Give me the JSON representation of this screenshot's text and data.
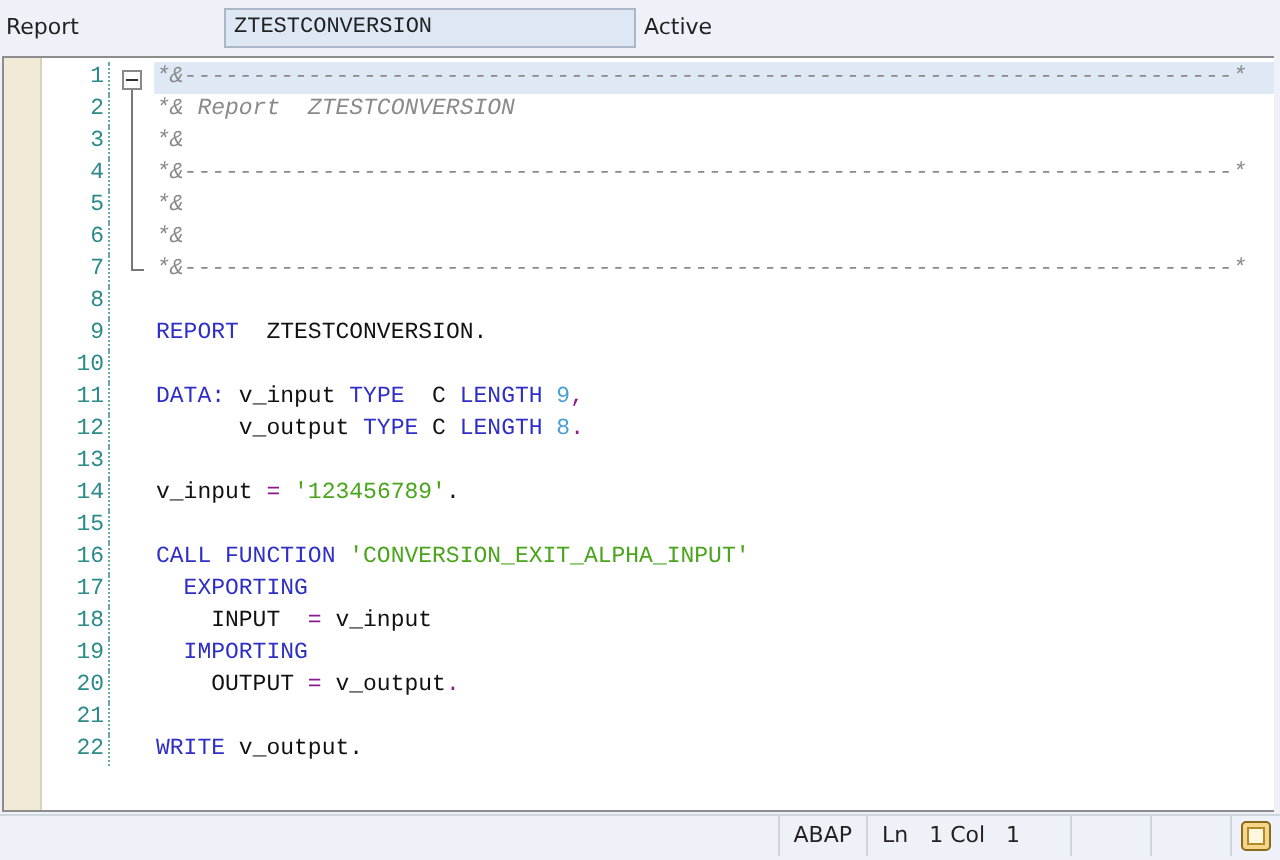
{
  "header": {
    "label": "Report",
    "program": "ZTESTCONVERSION",
    "status": "Active"
  },
  "editor": {
    "lines": [
      {
        "number": "1",
        "current": true,
        "expanded": true,
        "tokens": [
          {
            "kind": "comment",
            "text": "*&----------------------------------------------------------------------------*"
          }
        ],
        "children": [
          {
            "number": "2",
            "current": false,
            "tokens": [
              {
                "kind": "comment",
                "text": "*& Report  ZTESTCONVERSION"
              }
            ]
          },
          {
            "number": "3",
            "current": false,
            "tokens": [
              {
                "kind": "comment",
                "text": "*&"
              }
            ]
          },
          {
            "number": "4",
            "current": false,
            "tokens": [
              {
                "kind": "comment",
                "text": "*&----------------------------------------------------------------------------*"
              }
            ]
          },
          {
            "number": "5",
            "current": false,
            "tokens": [
              {
                "kind": "comment",
                "text": "*&"
              }
            ]
          },
          {
            "number": "6",
            "current": false,
            "tokens": [
              {
                "kind": "comment",
                "text": "*&"
              }
            ]
          },
          {
            "number": "7",
            "current": false,
            "tokens": [
              {
                "kind": "comment",
                "text": "*&----------------------------------------------------------------------------*"
              }
            ]
          }
        ]
      },
      {
        "number": "8",
        "current": false
      },
      {
        "number": "9",
        "current": false,
        "tokens": [
          {
            "kind": "keyword",
            "text": "REPORT"
          },
          {
            "kind": "plain",
            "text": "  ZTESTCONVERSION."
          }
        ]
      },
      {
        "number": "10",
        "current": false
      },
      {
        "number": "11",
        "current": false,
        "tokens": [
          {
            "kind": "keyword",
            "text": "DATA:"
          },
          {
            "kind": "plain",
            "text": " v_input "
          },
          {
            "kind": "keyword",
            "text": "TYPE"
          },
          {
            "kind": "plain",
            "text": "  C "
          },
          {
            "kind": "keyword",
            "text": "LENGTH "
          },
          {
            "kind": "number",
            "text": "9"
          },
          {
            "kind": "punct",
            "text": ","
          }
        ]
      },
      {
        "number": "12",
        "current": false,
        "tokens": [
          {
            "kind": "plain",
            "text": "      v_output "
          },
          {
            "kind": "keyword",
            "text": "TYPE"
          },
          {
            "kind": "plain",
            "text": " C "
          },
          {
            "kind": "keyword",
            "text": "LENGTH "
          },
          {
            "kind": "number",
            "text": "8"
          },
          {
            "kind": "punct",
            "text": "."
          }
        ]
      },
      {
        "number": "13",
        "current": false
      },
      {
        "number": "14",
        "current": false,
        "tokens": [
          {
            "kind": "plain",
            "text": "v_input "
          },
          {
            "kind": "punct",
            "text": "= "
          },
          {
            "kind": "string",
            "text": "'123456789'"
          },
          {
            "kind": "plain",
            "text": "."
          }
        ]
      },
      {
        "number": "15",
        "current": false
      },
      {
        "number": "16",
        "current": false,
        "tokens": [
          {
            "kind": "keyword",
            "text": "CALL FUNCTION "
          },
          {
            "kind": "string",
            "text": "'CONVERSION_EXIT_ALPHA_INPUT'"
          }
        ]
      },
      {
        "number": "17",
        "current": false,
        "tokens": [
          {
            "kind": "keyword",
            "text": "  EXPORTING"
          }
        ]
      },
      {
        "number": "18",
        "current": false,
        "tokens": [
          {
            "kind": "plain",
            "text": "    INPUT  "
          },
          {
            "kind": "punct",
            "text": "="
          },
          {
            "kind": "plain",
            "text": " v_input"
          }
        ]
      },
      {
        "number": "19",
        "current": false,
        "tokens": [
          {
            "kind": "keyword",
            "text": "  IMPORTING"
          }
        ]
      },
      {
        "number": "20",
        "current": false,
        "tokens": [
          {
            "kind": "plain",
            "text": "    OUTPUT "
          },
          {
            "kind": "punct",
            "text": "="
          },
          {
            "kind": "plain",
            "text": " v_output"
          },
          {
            "kind": "punct",
            "text": "."
          }
        ]
      },
      {
        "number": "21",
        "current": false
      },
      {
        "number": "22",
        "current": false,
        "tokens": [
          {
            "kind": "keyword",
            "text": "WRITE"
          },
          {
            "kind": "plain",
            "text": " v_output."
          }
        ]
      }
    ]
  },
  "status_bar": {
    "language": "ABAP",
    "position": "Ln   1 Col   1"
  }
}
